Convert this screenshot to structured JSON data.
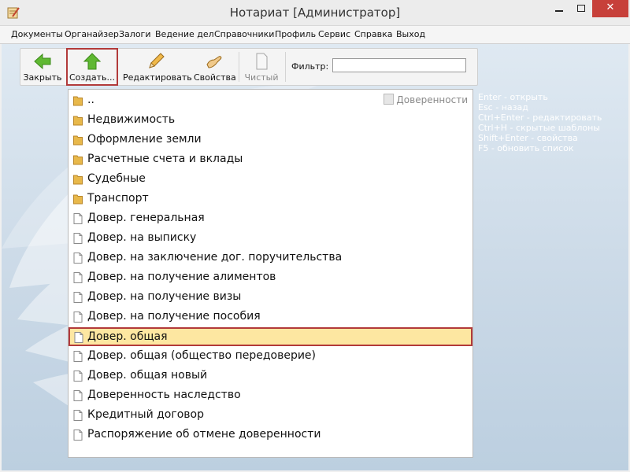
{
  "window": {
    "title": "Нотариат [Администратор]",
    "close_label": "✕"
  },
  "menu": [
    "Документы",
    "Органайзер",
    "Залоги",
    "Ведение дел",
    "Справочники",
    "Профиль",
    "Сервис",
    "Справка",
    "Выход"
  ],
  "toolbar": {
    "close_label": "Закрыть",
    "create_label": "Создать...",
    "edit_label": "Редактировать",
    "props_label": "Свойства",
    "clean_label": "Чистый",
    "filter_label": "Фильтр:",
    "filter_value": ""
  },
  "list": {
    "category": "Доверенности",
    "items": [
      {
        "label": "..",
        "type": "folder"
      },
      {
        "label": "Недвижимость",
        "type": "folder"
      },
      {
        "label": "Оформление земли",
        "type": "folder"
      },
      {
        "label": "Расчетные счета и вклады",
        "type": "folder"
      },
      {
        "label": "Судебные",
        "type": "folder"
      },
      {
        "label": "Транспорт",
        "type": "folder"
      },
      {
        "label": "Довер. генеральная",
        "type": "doc"
      },
      {
        "label": "Довер. на выписку",
        "type": "doc"
      },
      {
        "label": "Довер. на заключение дог. поручительства",
        "type": "doc"
      },
      {
        "label": "Довер. на получение алиментов",
        "type": "doc"
      },
      {
        "label": "Довер. на получение визы",
        "type": "doc"
      },
      {
        "label": "Довер. на получение пособия",
        "type": "doc"
      },
      {
        "label": "Довер. общая",
        "type": "doc",
        "selected": true
      },
      {
        "label": "Довер. общая (общество передоверие)",
        "type": "doc"
      },
      {
        "label": "Довер. общая новый",
        "type": "doc"
      },
      {
        "label": "Доверенность наследство",
        "type": "doc"
      },
      {
        "label": "Кредитный договор",
        "type": "doc"
      },
      {
        "label": "Распоряжение об отмене доверенности",
        "type": "doc"
      }
    ]
  },
  "shortcuts": [
    "Enter - открыть",
    "Esc - назад",
    "Ctrl+Enter - редактировать",
    "Ctrl+H - скрытые шаблоны",
    "Shift+Enter - свойства",
    "F5 - обновить список"
  ],
  "colors": {
    "selection_fill": "#fde7a1",
    "highlight_border": "#b23a3a",
    "folder": "#e8b84a"
  }
}
